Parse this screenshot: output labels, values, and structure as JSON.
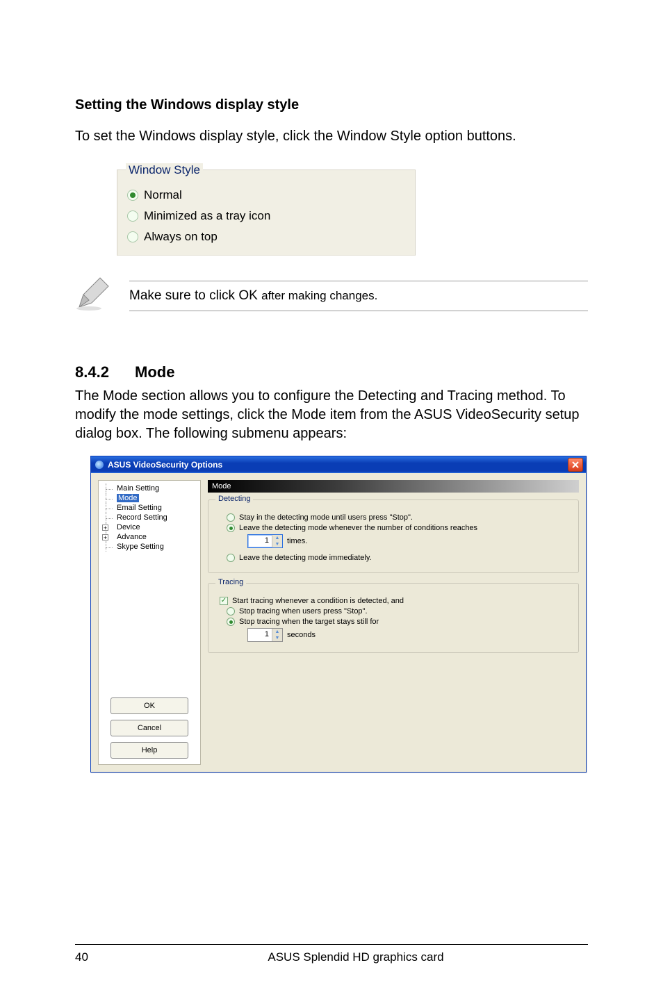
{
  "heading1": "Setting the Windows display style",
  "intro1": "To set the Windows display style, click the Window Style option buttons.",
  "winstyle": {
    "legend": "Window Style",
    "options": [
      {
        "label": "Normal",
        "selected": true
      },
      {
        "label": "Minimized as a tray icon",
        "selected": false
      },
      {
        "label": "Always on top",
        "selected": false
      }
    ]
  },
  "note_prefix": "Make sure to click OK ",
  "note_suffix": "after making changes.",
  "section": {
    "number": "8.4.2",
    "title": "Mode"
  },
  "section_body": "The Mode section allows you to configure the Detecting and Tracing method. To modify the mode settings, click the Mode item from the ASUS VideoSecurity setup dialog box. The following submenu appears:",
  "dialog": {
    "title": "ASUS VideoSecurity Options",
    "tree": {
      "items": [
        {
          "label": "Main Setting",
          "level": 1
        },
        {
          "label": "Mode",
          "level": 1,
          "selected": true
        },
        {
          "label": "Email Setting",
          "level": 1
        },
        {
          "label": "Record Setting",
          "level": 1
        },
        {
          "label": "Device",
          "level": 1,
          "expander": "+"
        },
        {
          "label": "Advance",
          "level": 1,
          "expander": "+"
        },
        {
          "label": "Skype Setting",
          "level": 1
        }
      ]
    },
    "buttons": {
      "ok": "OK",
      "cancel": "Cancel",
      "help": "Help"
    },
    "content_header": "Mode",
    "detecting": {
      "legend": "Detecting",
      "opt1": "Stay in the detecting mode until users press \"Stop\".",
      "opt2": "Leave the detecting mode whenever the number of conditions reaches",
      "opt2_selected": true,
      "times_value": "1",
      "times_suffix": "times.",
      "opt3": "Leave the detecting mode immediately."
    },
    "tracing": {
      "legend": "Tracing",
      "chk_label": "Start tracing whenever a condition is detected,   and",
      "chk_checked": true,
      "opt1": "Stop tracing when users press \"Stop\".",
      "opt2": "Stop tracing when the target stays still for",
      "opt2_selected": true,
      "seconds_value": "1",
      "seconds_suffix": "seconds"
    }
  },
  "footer": {
    "page": "40",
    "text": "ASUS Splendid HD graphics card"
  }
}
